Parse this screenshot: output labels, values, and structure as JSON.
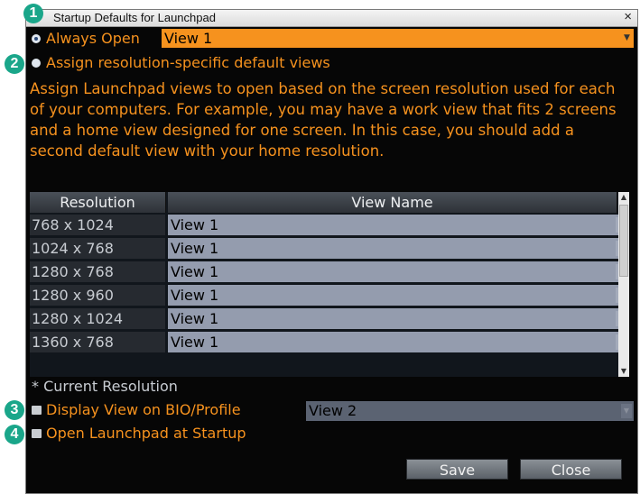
{
  "window": {
    "title": "Startup Defaults for Launchpad",
    "close_glyph": "×"
  },
  "options": {
    "always_open_label": "Always Open",
    "always_open_value": "View 1",
    "assign_label": "Assign resolution-specific default views",
    "description": "Assign Launchpad views to open based on the screen resolution used for each of your computers. For example, you may have a work view that fits 2 screens and a home view designed for one screen. In this case, you should add a second default view with your home resolution."
  },
  "table": {
    "columns": [
      "Resolution",
      "View Name"
    ],
    "rows": [
      {
        "resolution": "768 x 1024",
        "view": "View 1"
      },
      {
        "resolution": "1024 x 768",
        "view": "View 1"
      },
      {
        "resolution": "1280 x 768",
        "view": "View 1"
      },
      {
        "resolution": "1280 x 960",
        "view": "View 1"
      },
      {
        "resolution": "1280 x 1024",
        "view": "View 1"
      },
      {
        "resolution": "1360 x 768",
        "view": "View 1"
      }
    ]
  },
  "current_resolution_note": "* Current Resolution",
  "bio": {
    "label": "Display View on BIO/Profile",
    "value": "View 2"
  },
  "startup": {
    "label": "Open Launchpad at Startup"
  },
  "buttons": {
    "save": "Save",
    "close": "Close"
  },
  "callouts": [
    "1",
    "2",
    "3",
    "4"
  ],
  "colors": {
    "accent_orange": "#f6921e",
    "callout_teal": "#1aa68a",
    "background": "#060606"
  }
}
